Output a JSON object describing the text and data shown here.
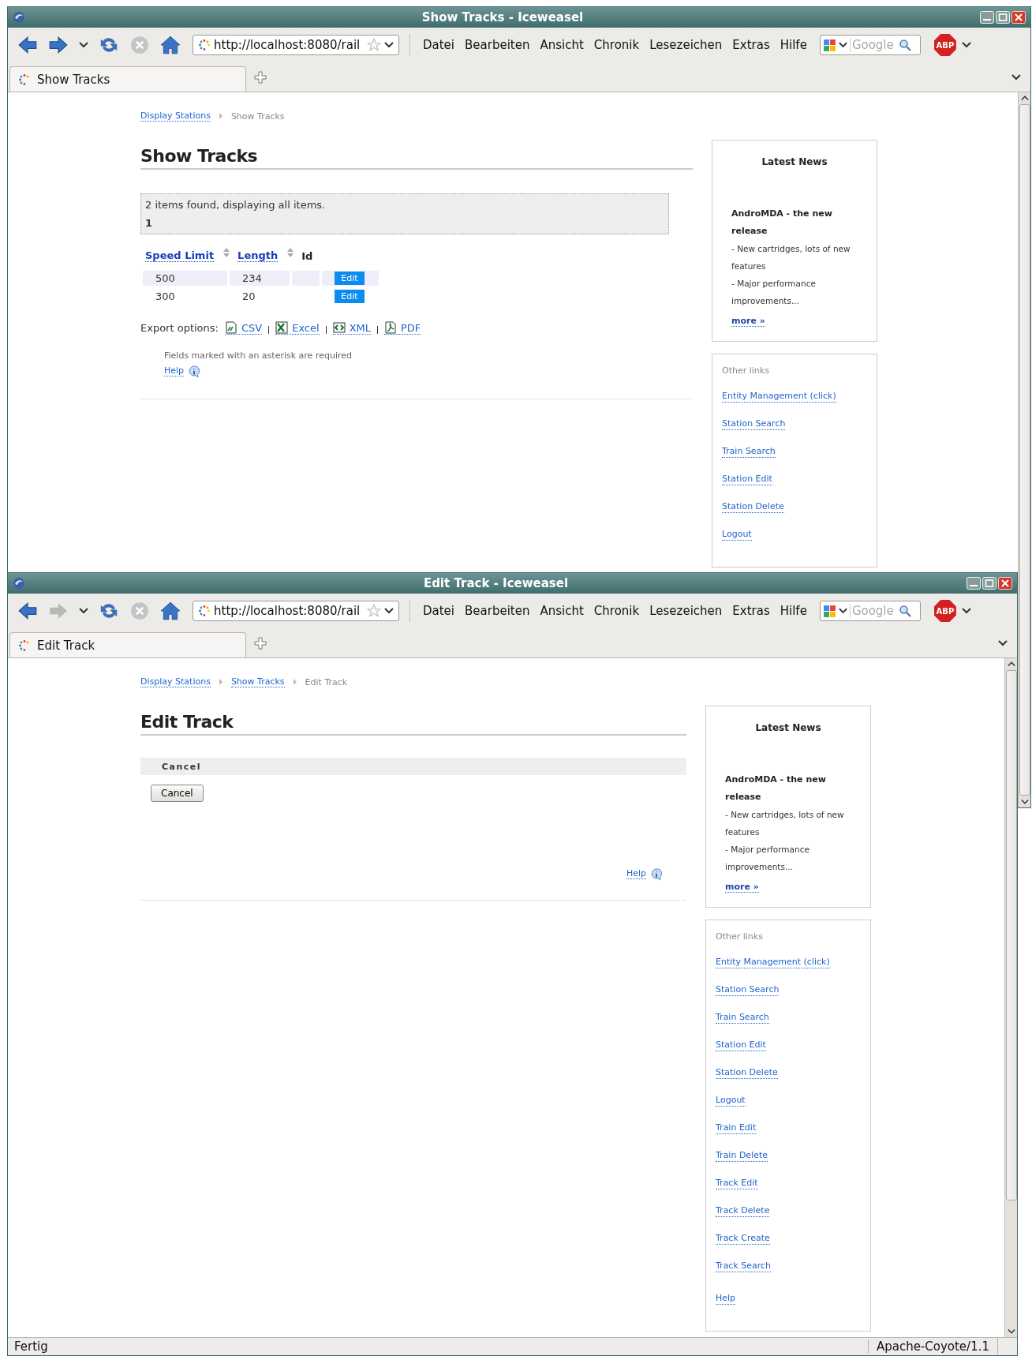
{
  "windows": [
    {
      "title": "Show Tracks - Iceweasel",
      "nav": [
        {
          "kind": "back",
          "disabled": false
        },
        {
          "kind": "forward",
          "disabled": false
        },
        {
          "kind": "history",
          "disabled": false
        },
        {
          "kind": "reload",
          "disabled": false
        },
        {
          "kind": "stop",
          "disabled": true
        },
        {
          "kind": "home",
          "disabled": false
        }
      ],
      "url": "http://localhost:8080/rail",
      "menu": [
        "Datei",
        "Bearbeiten",
        "Ansicht",
        "Chronik",
        "Lesezeichen",
        "Extras",
        "Hilfe"
      ],
      "search": {
        "placeholder": "Google"
      },
      "adblock": "ABP",
      "tabs": [
        {
          "label": "Show Tracks",
          "selected": true
        }
      ],
      "page": {
        "kind": "list",
        "breadcrumbs": [
          {
            "label": "Display Stations",
            "link": true
          },
          {
            "label": "Show Tracks",
            "link": false
          }
        ],
        "heading": "Show Tracks",
        "results": {
          "summary": "2 items found, displaying all items.",
          "page": "1"
        },
        "table": {
          "columns": [
            {
              "label": "Speed Limit",
              "sortable": true
            },
            {
              "label": "Length",
              "sortable": true
            },
            {
              "label": "Id",
              "sortable": false
            }
          ],
          "rows": [
            {
              "speed_limit": "500",
              "length": "234",
              "action": "Edit"
            },
            {
              "speed_limit": "300",
              "length": "20",
              "action": "Edit"
            }
          ]
        },
        "export": {
          "label": "Export options:",
          "options": [
            {
              "kind": "csv",
              "label": "CSV"
            },
            {
              "kind": "excel",
              "label": "Excel"
            },
            {
              "kind": "xml",
              "label": "XML"
            },
            {
              "kind": "pdf",
              "label": "PDF"
            }
          ]
        },
        "note": "Fields marked with an asterisk are required",
        "help": "Help"
      },
      "sidebar": {
        "news": {
          "title": "Latest News",
          "headline": "AndroMDA - the new release",
          "lines": [
            "- New cartridges, lots of new features",
            "- Major performance improvements..."
          ],
          "more": "more »"
        },
        "links": {
          "title": "Other links",
          "items": [
            "Entity Management (click)",
            "Station Search",
            "Train Search",
            "Station Edit",
            "Station Delete",
            "Logout"
          ]
        }
      }
    },
    {
      "title": "Edit Track - Iceweasel",
      "nav": [
        {
          "kind": "back",
          "disabled": false
        },
        {
          "kind": "forward",
          "disabled": true
        },
        {
          "kind": "history",
          "disabled": false
        },
        {
          "kind": "reload",
          "disabled": false
        },
        {
          "kind": "stop",
          "disabled": true
        },
        {
          "kind": "home",
          "disabled": false
        }
      ],
      "url": "http://localhost:8080/rail",
      "menu": [
        "Datei",
        "Bearbeiten",
        "Ansicht",
        "Chronik",
        "Lesezeichen",
        "Extras",
        "Hilfe"
      ],
      "search": {
        "placeholder": "Google"
      },
      "adblock": "ABP",
      "tabs": [
        {
          "label": "Edit Track",
          "selected": true
        }
      ],
      "page": {
        "kind": "edit",
        "breadcrumbs": [
          {
            "label": "Display Stations",
            "link": true
          },
          {
            "label": "Show Tracks",
            "link": true
          },
          {
            "label": "Edit Track",
            "link": false
          }
        ],
        "heading": "Edit Track",
        "form": {
          "legend": "Cancel",
          "button": "Cancel"
        },
        "help": "Help"
      },
      "sidebar": {
        "news": {
          "title": "Latest News",
          "headline": "AndroMDA - the new release",
          "lines": [
            "- New cartridges, lots of new features",
            "- Major performance improvements..."
          ],
          "more": "more »"
        },
        "links": {
          "title": "Other links",
          "items": [
            "Entity Management (click)",
            "Station Search",
            "Train Search",
            "Station Edit",
            "Station Delete",
            "Logout",
            "Train Edit",
            "Train Delete",
            "Track Edit",
            "Track Delete",
            "Track Create",
            "Track Search"
          ],
          "help": "Help"
        }
      },
      "status_bar": {
        "left": "Fertig",
        "right": "Apache-Coyote/1.1"
      }
    }
  ]
}
